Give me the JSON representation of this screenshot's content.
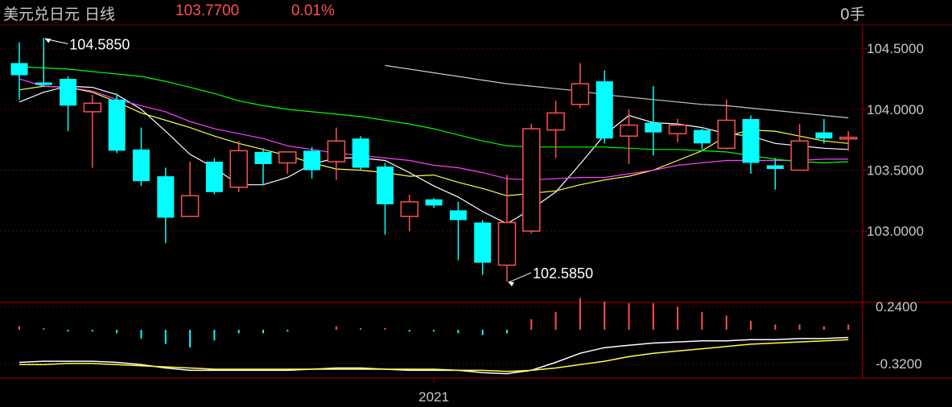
{
  "header": {
    "symbol": "美元兑日元  日线",
    "last_price": "103.7700",
    "change_pct": "0.01%",
    "volume": "0手"
  },
  "chart_data": {
    "type": "candlestick",
    "price_axis": {
      "ticks": [
        104.5,
        104.0,
        103.5,
        103.0
      ],
      "tick_labels": [
        "104.5000",
        "104.0000",
        "103.5000",
        "103.0000"
      ],
      "ylim": [
        102.44,
        104.66
      ]
    },
    "indicator_axis": {
      "tick_labels": [
        "0.2400",
        "-0.3200"
      ],
      "ylim": [
        -0.37,
        0.24
      ]
    },
    "x_labels": [
      {
        "index": 17,
        "label": "2021"
      }
    ],
    "annotations": [
      {
        "label": "104.5850",
        "index": 1,
        "value": 104.585
      },
      {
        "label": "102.5850",
        "index": 20,
        "value": 102.585
      }
    ],
    "candles": [
      {
        "o": 104.38,
        "h": 104.55,
        "l": 104.08,
        "c": 104.28
      },
      {
        "o": 104.22,
        "h": 104.585,
        "l": 104.19,
        "c": 104.2
      },
      {
        "o": 104.25,
        "h": 104.27,
        "l": 103.82,
        "c": 104.03
      },
      {
        "o": 103.98,
        "h": 104.12,
        "l": 103.52,
        "c": 104.05
      },
      {
        "o": 104.08,
        "h": 104.13,
        "l": 103.64,
        "c": 103.66
      },
      {
        "o": 103.67,
        "h": 103.85,
        "l": 103.37,
        "c": 103.41
      },
      {
        "o": 103.45,
        "h": 103.52,
        "l": 102.9,
        "c": 103.11
      },
      {
        "o": 103.12,
        "h": 103.57,
        "l": 103.12,
        "c": 103.29
      },
      {
        "o": 103.57,
        "h": 103.6,
        "l": 103.3,
        "c": 103.32
      },
      {
        "o": 103.36,
        "h": 103.74,
        "l": 103.32,
        "c": 103.66
      },
      {
        "o": 103.65,
        "h": 103.68,
        "l": 103.38,
        "c": 103.55
      },
      {
        "o": 103.56,
        "h": 103.65,
        "l": 103.47,
        "c": 103.65
      },
      {
        "o": 103.66,
        "h": 103.69,
        "l": 103.43,
        "c": 103.5
      },
      {
        "o": 103.57,
        "h": 103.85,
        "l": 103.42,
        "c": 103.74
      },
      {
        "o": 103.76,
        "h": 103.78,
        "l": 103.5,
        "c": 103.52
      },
      {
        "o": 103.53,
        "h": 103.56,
        "l": 102.97,
        "c": 103.22
      },
      {
        "o": 103.12,
        "h": 103.3,
        "l": 103.0,
        "c": 103.24
      },
      {
        "o": 103.26,
        "h": 103.27,
        "l": 103.19,
        "c": 103.21
      },
      {
        "o": 103.17,
        "h": 103.24,
        "l": 102.76,
        "c": 103.09
      },
      {
        "o": 103.07,
        "h": 103.09,
        "l": 102.64,
        "c": 102.74
      },
      {
        "o": 102.72,
        "h": 103.46,
        "l": 102.585,
        "c": 103.07
      },
      {
        "o": 103.0,
        "h": 103.88,
        "l": 102.98,
        "c": 103.84
      },
      {
        "o": 103.83,
        "h": 104.07,
        "l": 103.6,
        "c": 103.97
      },
      {
        "o": 104.04,
        "h": 104.38,
        "l": 104.01,
        "c": 104.21
      },
      {
        "o": 104.23,
        "h": 104.32,
        "l": 103.72,
        "c": 103.76
      },
      {
        "o": 103.78,
        "h": 104.0,
        "l": 103.55,
        "c": 103.87
      },
      {
        "o": 103.89,
        "h": 104.19,
        "l": 103.62,
        "c": 103.81
      },
      {
        "o": 103.8,
        "h": 103.92,
        "l": 103.73,
        "c": 103.87
      },
      {
        "o": 103.83,
        "h": 103.84,
        "l": 103.67,
        "c": 103.72
      },
      {
        "o": 103.68,
        "h": 104.08,
        "l": 103.67,
        "c": 103.91
      },
      {
        "o": 103.92,
        "h": 103.95,
        "l": 103.47,
        "c": 103.56
      },
      {
        "o": 103.54,
        "h": 103.6,
        "l": 103.34,
        "c": 103.51
      },
      {
        "o": 103.5,
        "h": 103.88,
        "l": 103.5,
        "c": 103.74
      },
      {
        "o": 103.81,
        "h": 103.92,
        "l": 103.72,
        "c": 103.76
      },
      {
        "o": 103.76,
        "h": 103.82,
        "l": 103.66,
        "c": 103.77
      }
    ],
    "moving_averages": [
      {
        "color": "#ffffff",
        "values": [
          104.06,
          104.14,
          104.19,
          104.18,
          104.12,
          104.0,
          103.82,
          103.63,
          103.52,
          103.38,
          103.38,
          103.44,
          103.55,
          103.6,
          103.6,
          103.58,
          103.48,
          103.37,
          103.28,
          103.16,
          103.06,
          103.18,
          103.32,
          103.55,
          103.79,
          103.95,
          103.89,
          103.88,
          103.85,
          103.8,
          103.78,
          103.72,
          103.7,
          103.68,
          103.67
        ]
      },
      {
        "color": "#ffff40",
        "values": [
          104.16,
          104.19,
          104.18,
          104.14,
          104.06,
          103.97,
          103.91,
          103.85,
          103.78,
          103.72,
          103.67,
          103.62,
          103.56,
          103.51,
          103.5,
          103.48,
          103.45,
          103.46,
          103.4,
          103.35,
          103.29,
          103.31,
          103.33,
          103.38,
          103.42,
          103.45,
          103.5,
          103.58,
          103.66,
          103.78,
          103.83,
          103.82,
          103.78,
          103.74,
          103.72
        ]
      },
      {
        "color": "#ff40ff",
        "values": [
          104.25,
          104.19,
          104.18,
          104.15,
          104.08,
          104.03,
          103.98,
          103.9,
          103.84,
          103.8,
          103.76,
          103.7,
          103.67,
          103.64,
          103.62,
          103.6,
          103.58,
          103.54,
          103.52,
          103.48,
          103.43,
          103.42,
          103.43,
          103.44,
          103.44,
          103.47,
          103.5,
          103.54,
          103.56,
          103.58,
          103.58,
          103.58,
          103.58,
          103.59,
          103.59
        ]
      },
      {
        "color": "#00ff00",
        "values": [
          104.35,
          104.34,
          104.33,
          104.31,
          104.29,
          104.27,
          104.23,
          104.18,
          104.13,
          104.07,
          104.03,
          104.0,
          103.98,
          103.96,
          103.94,
          103.91,
          103.88,
          103.84,
          103.79,
          103.74,
          103.7,
          103.69,
          103.69,
          103.69,
          103.69,
          103.68,
          103.67,
          103.67,
          103.66,
          103.65,
          103.62,
          103.59,
          103.57,
          103.56,
          103.57
        ]
      },
      {
        "color": "#c8c8c8",
        "values": [
          null,
          null,
          null,
          null,
          null,
          null,
          null,
          null,
          null,
          null,
          null,
          null,
          null,
          null,
          null,
          104.36,
          104.33,
          104.3,
          104.27,
          104.24,
          104.21,
          104.19,
          104.17,
          104.15,
          104.12,
          104.1,
          104.08,
          104.06,
          104.04,
          104.03,
          104.01,
          103.99,
          103.97,
          103.95,
          103.93
        ]
      }
    ],
    "indicator": {
      "histogram": [
        0.02,
        0.01,
        -0.01,
        -0.01,
        -0.02,
        -0.05,
        -0.08,
        -0.1,
        -0.06,
        -0.02,
        -0.02,
        -0.01,
        0.0,
        0.02,
        0.01,
        0.01,
        -0.01,
        -0.01,
        -0.02,
        -0.03,
        -0.02,
        0.06,
        0.1,
        0.18,
        0.16,
        0.15,
        0.15,
        0.13,
        0.1,
        0.08,
        0.05,
        0.03,
        0.03,
        0.02,
        0.03
      ],
      "lines": [
        {
          "color": "#ffffff",
          "values": [
            -0.26,
            -0.25,
            -0.25,
            -0.25,
            -0.26,
            -0.28,
            -0.31,
            -0.33,
            -0.33,
            -0.33,
            -0.33,
            -0.33,
            -0.32,
            -0.31,
            -0.31,
            -0.32,
            -0.33,
            -0.33,
            -0.33,
            -0.35,
            -0.36,
            -0.33,
            -0.26,
            -0.18,
            -0.13,
            -0.11,
            -0.09,
            -0.08,
            -0.07,
            -0.07,
            -0.06,
            -0.06,
            -0.05,
            -0.05,
            -0.04
          ]
        },
        {
          "color": "#ffff40",
          "values": [
            -0.28,
            -0.28,
            -0.27,
            -0.27,
            -0.28,
            -0.29,
            -0.3,
            -0.31,
            -0.32,
            -0.32,
            -0.32,
            -0.32,
            -0.32,
            -0.32,
            -0.32,
            -0.32,
            -0.32,
            -0.32,
            -0.33,
            -0.33,
            -0.34,
            -0.33,
            -0.31,
            -0.28,
            -0.25,
            -0.21,
            -0.18,
            -0.16,
            -0.14,
            -0.12,
            -0.1,
            -0.09,
            -0.08,
            -0.07,
            -0.06
          ]
        }
      ]
    }
  }
}
